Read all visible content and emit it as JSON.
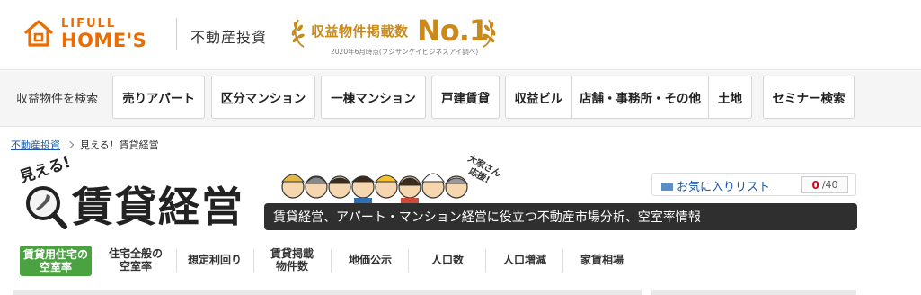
{
  "header": {
    "logo_top": "LIFULL",
    "logo_bottom": "HOME'S",
    "subbrand": "不動産投資",
    "award_text": "収益物件掲載数",
    "award_rank": "No.1",
    "award_note": "2020年6月時点(フジサンケイビジネスアイ調べ)"
  },
  "nav": {
    "label": "収益物件を検索",
    "items": [
      "売りアパート",
      "区分マンション",
      "一棟マンション",
      "戸建賃貸",
      "収益ビル",
      "店舗・事務所・その他",
      "土地",
      "セミナー検索"
    ]
  },
  "breadcrumb": {
    "home": "不動産投資",
    "current": "見える！賃貸経営"
  },
  "title": {
    "mieru": "見える!",
    "kanji": "賃貸経営",
    "stamp": "大家さん応援!",
    "description": "賃貸経営、アパート・マンション経営に役立つ不動産市場分析、空室率情報"
  },
  "favorites": {
    "label": "お気に入りリスト",
    "count": "0",
    "total": "/40"
  },
  "tabs": [
    {
      "line1": "賃貸用住宅の",
      "line2": "空室率"
    },
    {
      "line1": "住宅全般の",
      "line2": "空室率"
    },
    {
      "line1": "想定利回り",
      "line2": ""
    },
    {
      "line1": "賃貸掲載",
      "line2": "物件数"
    },
    {
      "line1": "地価公示",
      "line2": ""
    },
    {
      "line1": "人口数",
      "line2": ""
    },
    {
      "line1": "人口増減",
      "line2": ""
    },
    {
      "line1": "家賃相場",
      "line2": ""
    }
  ],
  "colors": {
    "brand_orange": "#ed6c00",
    "award_gold": "#c98a1a",
    "active_tab": "#4aa241",
    "desc_bar": "#2f2f2f",
    "link": "#1a5aa8"
  }
}
